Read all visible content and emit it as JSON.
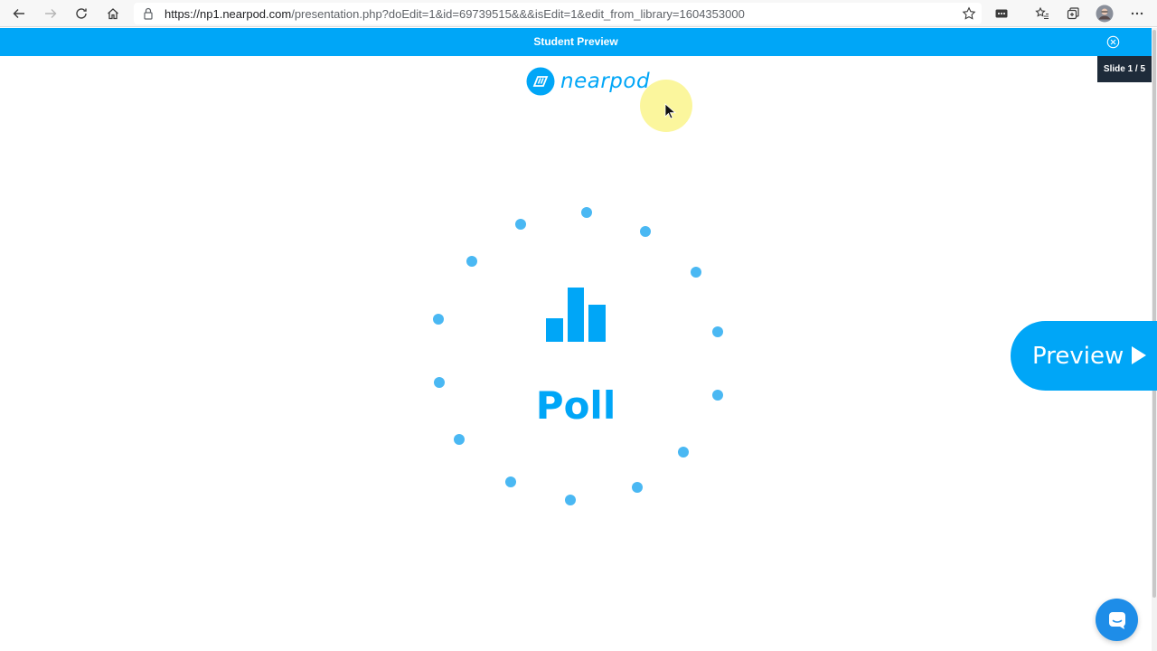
{
  "browser": {
    "url_host": "https://np1.nearpod.com",
    "url_path": "/presentation.php?doEdit=1&id=69739515&&&isEdit=1&edit_from_library=1604353000",
    "icons": [
      "back-icon",
      "forward-icon",
      "refresh-icon",
      "home-icon",
      "lock-icon",
      "star-icon",
      "extension-icon",
      "favorites-icon",
      "collections-icon",
      "profile-avatar",
      "more-icon"
    ]
  },
  "header": {
    "title": "Student Preview",
    "close_icon": "close-circle-icon"
  },
  "slide_counter": "Slide 1 / 5",
  "logo": {
    "text": "nearpod"
  },
  "activity": {
    "label": "Poll",
    "icon": "bar-chart-icon"
  },
  "preview_button": {
    "label": "Preview",
    "icon": "play-icon"
  },
  "chat": {
    "icon": "chat-bubble-icon"
  },
  "colors": {
    "accent": "#00a6f7",
    "dots": "#4ab8f3",
    "badge_bg": "#1e2b3a",
    "chat": "#1e8de8"
  }
}
